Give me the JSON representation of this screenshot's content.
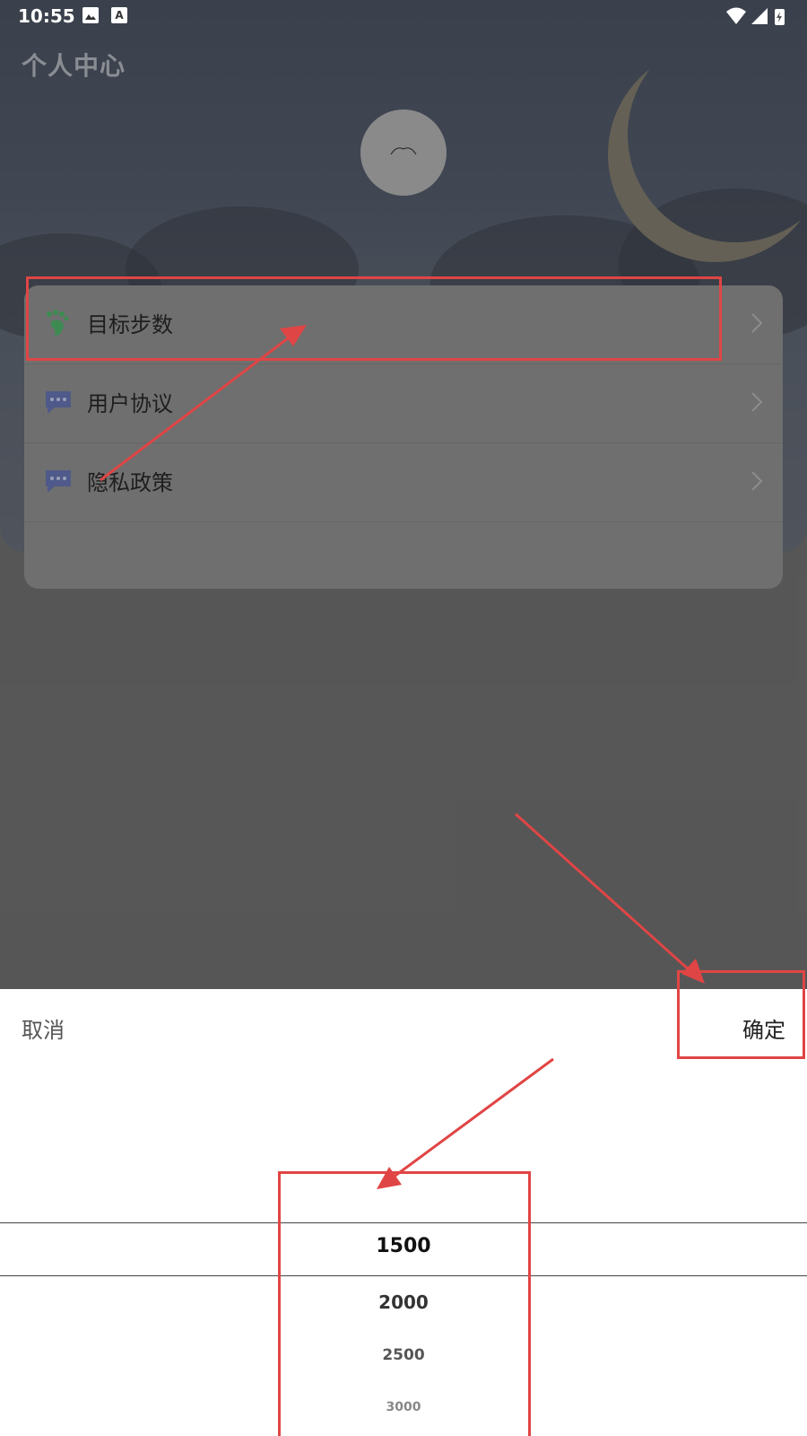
{
  "status_bar": {
    "time": "10:55",
    "icons": [
      "image-icon",
      "text-a-icon",
      "wifi-icon",
      "signal-icon",
      "battery-icon"
    ],
    "a_glyph": "A"
  },
  "page": {
    "title": "个人中心"
  },
  "menu": {
    "items": [
      {
        "label": "目标步数",
        "icon": "footprint-icon",
        "icon_color": "#3d8b52"
      },
      {
        "label": "用户协议",
        "icon": "chat-icon",
        "icon_color": "#4f5a8a"
      },
      {
        "label": "隐私政策",
        "icon": "chat-icon",
        "icon_color": "#4f5a8a"
      }
    ]
  },
  "picker": {
    "cancel_label": "取消",
    "confirm_label": "确定",
    "options": [
      "1500",
      "2000",
      "2500",
      "3000"
    ],
    "selected": "1500"
  },
  "colors": {
    "annotation": "#e04545",
    "overlay": "#6b6b6b",
    "sheet": "#ffffff"
  }
}
